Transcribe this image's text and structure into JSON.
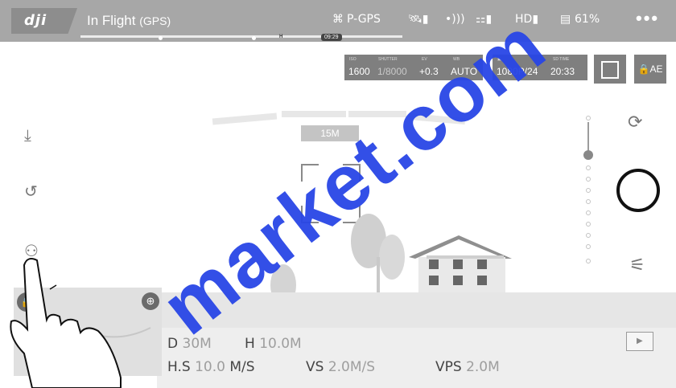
{
  "topbar": {
    "logo": "dji",
    "status_main": "In Flight",
    "status_sub": "(GPS)",
    "mode": "P-GPS",
    "hd": "HD",
    "battery": "61%",
    "more": "•••",
    "timeline_h": "H",
    "timeline_time": "09:29"
  },
  "camera": {
    "iso_label": "ISO",
    "iso": "1600",
    "shutter_label": "SHUTTER",
    "shutter": "1/8000",
    "ev_label": "EV",
    "ev": "+0.3",
    "wb_label": "WB",
    "wb": "AUTO",
    "format": "1080P/24",
    "time_label": "SD TIME",
    "time": "20:33",
    "ae_label": "AE"
  },
  "obstacle": {
    "distance": "15M"
  },
  "telemetry": {
    "d_label": "D",
    "d_value": "30M",
    "h_label": "H",
    "h_value": "10.0M",
    "hs_label": "H.S",
    "hs_value": "10.0",
    "hs_unit": "M/S",
    "vs_label": "VS",
    "vs_value": "2.0M/S",
    "vps_label": "VPS",
    "vps_value": "2.0M"
  },
  "watermark": "market.com",
  "colors": {
    "watermark": "#2846e6",
    "topbar": "#a7a7a7",
    "panel": "#7f7f7f"
  },
  "icons": [
    "takeoff-icon",
    "return-home-icon",
    "remote-controller-icon",
    "camera-switch-icon",
    "shutter-button-icon",
    "camera-settings-icon",
    "playback-icon",
    "lock-icon",
    "crosshair-icon",
    "aircraft-icon",
    "gps-signal-icon",
    "rc-signal-icon"
  ]
}
